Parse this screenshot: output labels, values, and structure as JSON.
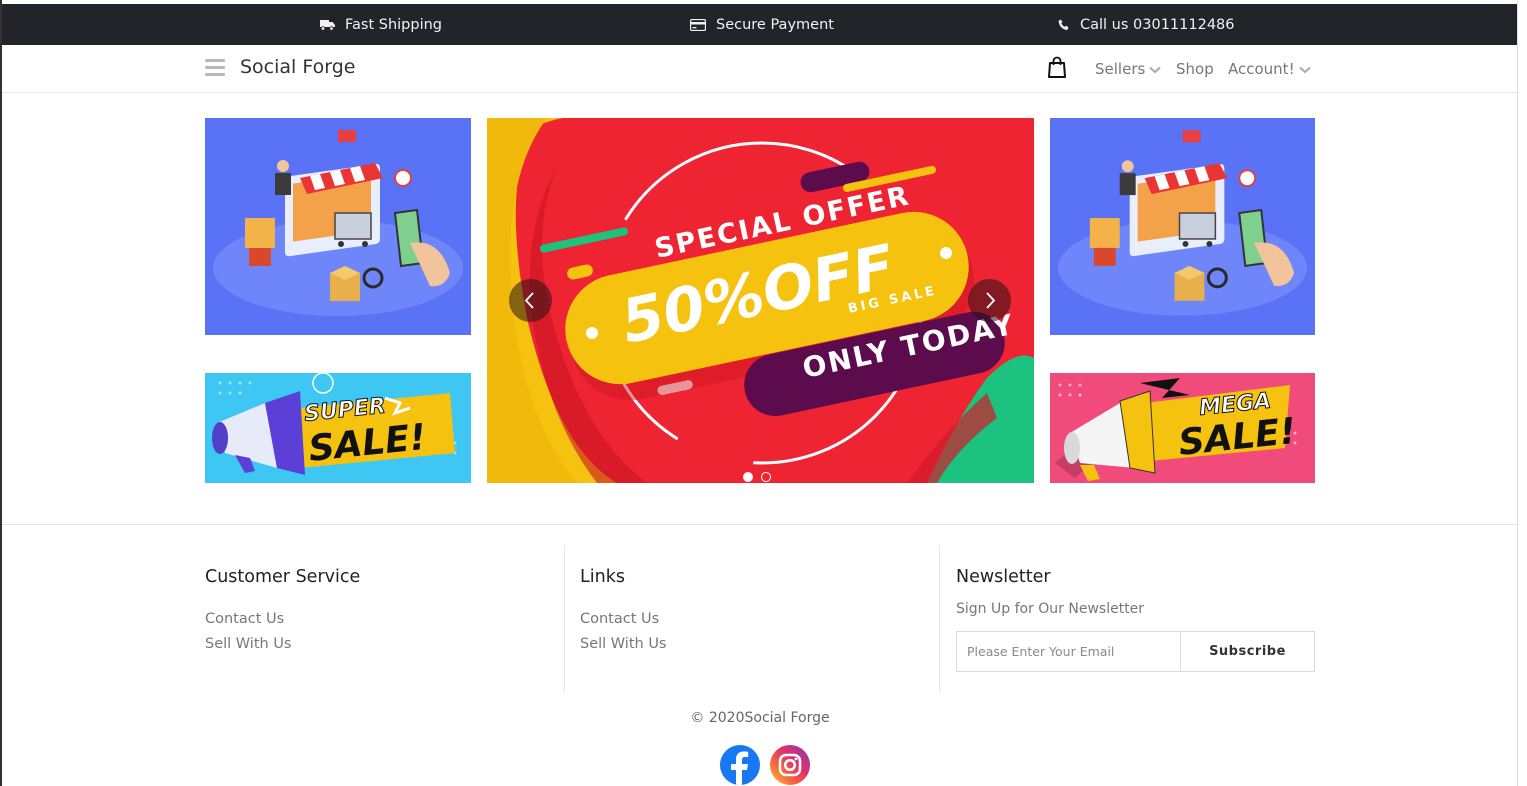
{
  "topbar": {
    "shipping": "Fast Shipping",
    "payment": "Secure Payment",
    "phone": "Call us 03011112486",
    "icons": [
      "truck-icon",
      "credit-card-icon",
      "phone-icon"
    ]
  },
  "navbar": {
    "brand": "Social Forge",
    "sellers": "Sellers",
    "shop": "Shop",
    "account": "Account!",
    "icons": [
      "hamburger-menu-icon",
      "shopping-bag-icon",
      "chevron-down-icon"
    ]
  },
  "hero": {
    "slide": {
      "line1": "SPECIAL OFFER",
      "line2": "50%OFF",
      "line3": "BIG SALE",
      "line4": "ONLY TODAY"
    },
    "super_sale": {
      "word1": "SUPER",
      "word2": "SALE!"
    },
    "mega_sale": {
      "word1": "MEGA",
      "word2": "SALE!"
    },
    "slides_total": 2,
    "active_slide": 1
  },
  "footer": {
    "customer_service": {
      "title": "Customer Service",
      "links": [
        "Contact Us",
        "Sell With Us"
      ]
    },
    "links": {
      "title": "Links",
      "links": [
        "Contact Us",
        "Sell With Us"
      ]
    },
    "newsletter": {
      "title": "Newsletter",
      "subtitle": "Sign Up for Our Newsletter",
      "placeholder": "Please Enter Your Email",
      "button": "Subscribe"
    },
    "copyright": "© 2020Social Forge",
    "social": [
      "facebook-icon",
      "instagram-icon"
    ]
  },
  "colors": {
    "topbar_bg": "#212529",
    "hero_red": "#ef2432",
    "hero_yellow": "#f5c20f",
    "hero_purple": "#5c0b4d",
    "isometric_blue": "#5a72f6",
    "super_sale_blue": "#3ec7f2",
    "mega_sale_pink": "#f04b7a",
    "facebook_blue": "#1877f2"
  }
}
